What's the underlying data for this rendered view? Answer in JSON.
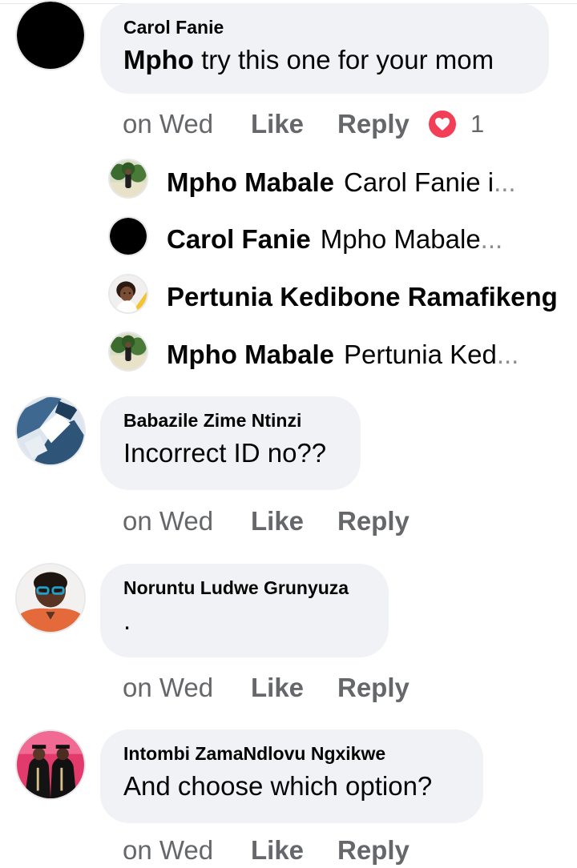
{
  "comments": [
    {
      "author": "Carol Fanie",
      "mention": "Mpho",
      "text": " try this one for your mom",
      "time": "on Wed",
      "like": "Like",
      "reply": "Reply",
      "reaction": {
        "type": "love",
        "count": "1",
        "color": "#f33e58"
      }
    },
    {
      "author": "Babazile Zime Ntinzi",
      "text": "Incorrect ID no??",
      "time": "on Wed",
      "like": "Like",
      "reply": "Reply"
    },
    {
      "author": "Noruntu Ludwe Grunyuza",
      "text": ".",
      "time": "on Wed",
      "like": "Like",
      "reply": "Reply"
    },
    {
      "author": "Intombi ZamaNdlovu Ngxikwe",
      "text": "And choose which option?"
    }
  ],
  "replies": [
    {
      "author": "Mpho Mabale",
      "text": "Carol Fanie i",
      "ellipsis": "..."
    },
    {
      "author": "Carol Fanie",
      "text": "Mpho Mabale ",
      "ellipsis": "..."
    },
    {
      "author": "Pertunia Kedibone Ramafikeng",
      "text": "",
      "ellipsis": ""
    },
    {
      "author": "Mpho Mabale",
      "text": "Pertunia Ked",
      "ellipsis": "..."
    }
  ],
  "colors": {
    "bubble": "#f0f2f5",
    "meta_text": "#65676b",
    "love_reaction": "#f33e58"
  },
  "icons": {
    "reaction": "heart-icon"
  }
}
